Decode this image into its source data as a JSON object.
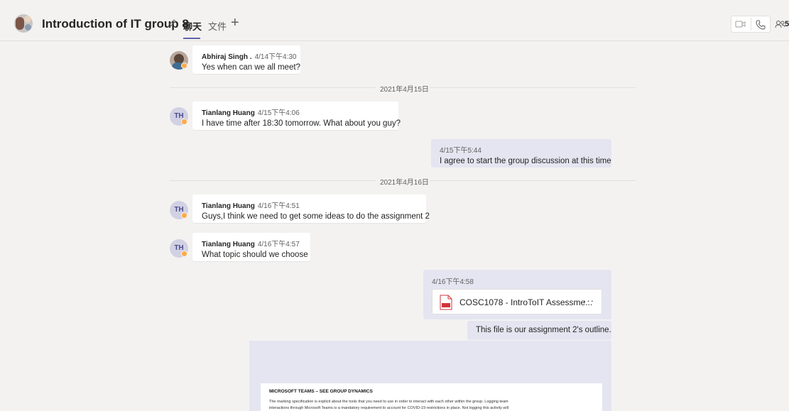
{
  "header": {
    "title": "Introduction of IT group 8",
    "tabs": [
      {
        "label": "聊天"
      },
      {
        "label": "文件"
      }
    ],
    "add_tab": "+",
    "participant_count": "5"
  },
  "messages": [
    {
      "author": "Abhiraj Singh .",
      "time": "4/14下午4:30",
      "text": "Yes when can we all meet?"
    },
    {
      "author": "Tianlang Huang",
      "initials": "TH",
      "time": "4/15下午4:06",
      "text": "I have time after 18:30 tomorrow. What about you guy?"
    },
    {
      "time": "4/15下午5:44",
      "text": "I agree to start the group discussion at this time"
    },
    {
      "author": "Tianlang Huang",
      "initials": "TH",
      "time": "4/16下午4:51",
      "text": "Guys,I think we need to get some ideas to do the assignment 2"
    },
    {
      "author": "Tianlang Huang",
      "initials": "TH",
      "time": "4/16下午4:57",
      "text": "What topic should we choose"
    },
    {
      "time": "4/16下午4:58",
      "file_name": "COSC1078 - IntroToIT Assessme...",
      "file_more": "···",
      "text": "This file is our assignment 2's outline."
    }
  ],
  "date_dividers": [
    "2021年4月15日",
    "2021年4月16日"
  ],
  "preview": {
    "heading": "MICROSOFT TEAMS – SEE GROUP DYNAMICS",
    "line1": "The marking specification is explicit about the tools that you need to use in order to interact with each other within the group. Logging team",
    "line2": "interactions through Microsoft Teams is a mandatory requirement to account for COVID-19 restrictions in place. Not logging this activity will"
  },
  "colors": {
    "accent": "#6264a7",
    "away_status": "#ffaa44",
    "my_bubble": "#e5e5f1",
    "pdf_red": "#d13438"
  }
}
